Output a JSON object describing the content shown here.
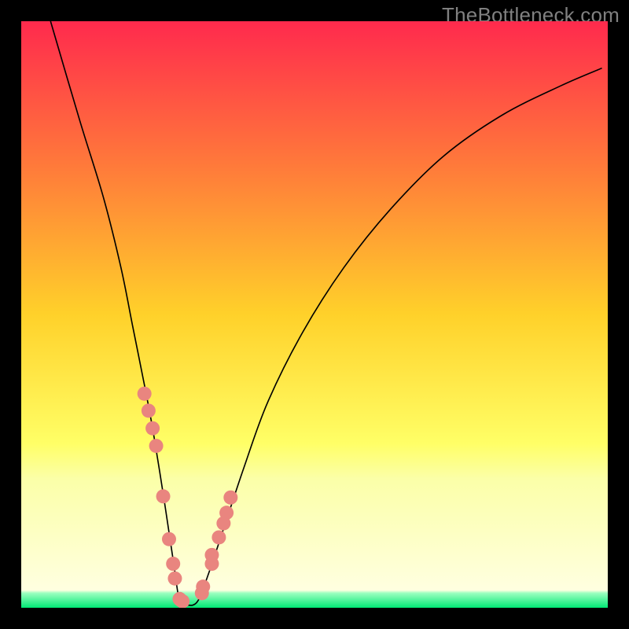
{
  "watermark": "TheBottleneck.com",
  "chart_data": {
    "type": "line",
    "title": "",
    "xlabel": "",
    "ylabel": "",
    "xlim": [
      0,
      100
    ],
    "ylim": [
      0,
      100
    ],
    "background_gradient": {
      "stops": [
        {
          "pos": 0.0,
          "color": "#FF2A4D"
        },
        {
          "pos": 0.25,
          "color": "#FF7B3A"
        },
        {
          "pos": 0.5,
          "color": "#FFD12A"
        },
        {
          "pos": 0.72,
          "color": "#FFFF66"
        },
        {
          "pos": 0.78,
          "color": "#FBFFA8"
        },
        {
          "pos": 0.97,
          "color": "#FFFFE0"
        },
        {
          "pos": 0.975,
          "color": "#9BFFC0"
        },
        {
          "pos": 1.0,
          "color": "#00E874"
        }
      ]
    },
    "series": [
      {
        "name": "bottleneck-curve",
        "color": "#000000",
        "x": [
          5,
          10,
          14,
          17,
          19,
          21,
          22.5,
          24.5,
          26,
          27,
          28,
          30,
          32,
          35,
          38,
          42,
          48,
          55,
          63,
          72,
          82,
          92,
          99
        ],
        "values": [
          100,
          83,
          70,
          58,
          48,
          38,
          30,
          17.5,
          7.5,
          1,
          0.5,
          1,
          6,
          15,
          24,
          35,
          47,
          58,
          68,
          77,
          84,
          89,
          92
        ]
      }
    ],
    "markers": {
      "name": "highlight-points",
      "color": "#E9857F",
      "radius_screen_px": 9,
      "x": [
        21.0,
        21.7,
        22.4,
        23.0,
        24.2,
        25.2,
        25.9,
        26.2,
        27.0,
        27.2,
        27.5,
        30.8,
        31.0,
        32.5,
        32.5,
        33.7,
        34.5,
        35.0,
        35.7
      ],
      "values": [
        36.5,
        33.6,
        30.6,
        27.6,
        19.0,
        11.7,
        7.5,
        5.0,
        1.5,
        1.3,
        1.1,
        2.5,
        3.6,
        7.5,
        9.0,
        12.0,
        14.4,
        16.2,
        18.8
      ]
    }
  }
}
